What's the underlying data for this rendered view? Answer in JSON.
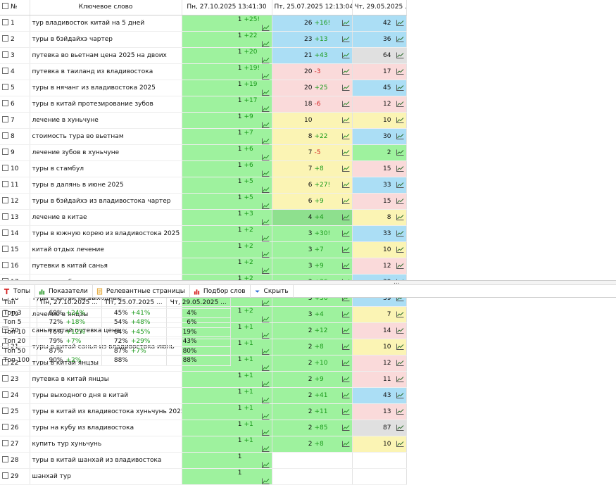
{
  "columns": {
    "num": "№",
    "keyword": "Ключевое слово",
    "date1": "Пн, 27.10.2025 13:41:30",
    "date2": "Пт, 25.07.2025 12:13:04",
    "date3": "Чт, 29.05.2025 ..."
  },
  "cell_colors": {
    "g": "#9ef29e",
    "b": "#abdef5",
    "p": "#fadada",
    "y": "#fbf4b4",
    "s": "#e0e0e0",
    "dg": "#8ee08e"
  },
  "rows": [
    {
      "n": "1",
      "kw": "тур владивосток китай на 5 дней",
      "p1": "1",
      "d1": "+25!",
      "c1": "g",
      "p2": "26",
      "d2": "+16!",
      "c2": "b",
      "p3": "42",
      "c3": "b"
    },
    {
      "n": "2",
      "kw": "туры в бэйдайхэ чартер",
      "p1": "1",
      "d1": "+22",
      "c1": "g",
      "p2": "23",
      "d2": "+13",
      "c2": "b",
      "p3": "36",
      "c3": "b"
    },
    {
      "n": "3",
      "kw": "путевка во вьетнам цена 2025 на двоих",
      "p1": "1",
      "d1": "+20",
      "c1": "g",
      "p2": "21",
      "d2": "+43",
      "c2": "b",
      "p3": "64",
      "c3": "s"
    },
    {
      "n": "4",
      "kw": "путевка в таиланд из владивостока",
      "p1": "1",
      "d1": "+19!",
      "c1": "g",
      "p2": "20",
      "d2": "-3",
      "c2": "p",
      "p3": "17",
      "c3": "p"
    },
    {
      "n": "5",
      "kw": "туры в нячанг из владивостока 2025",
      "p1": "1",
      "d1": "+19",
      "c1": "g",
      "p2": "20",
      "d2": "+25",
      "c2": "p",
      "p3": "45",
      "c3": "b"
    },
    {
      "n": "6",
      "kw": "туры в китай протезирование зубов",
      "p1": "1",
      "d1": "+17",
      "c1": "g",
      "p2": "18",
      "d2": "-6",
      "c2": "p",
      "p3": "12",
      "c3": "p"
    },
    {
      "n": "7",
      "kw": "лечение в хуньчуне",
      "p1": "1",
      "d1": "+9",
      "c1": "g",
      "p2": "10",
      "d2": "",
      "c2": "y",
      "p3": "10",
      "c3": "y"
    },
    {
      "n": "8",
      "kw": "стоимость тура во вьетнам",
      "p1": "1",
      "d1": "+7",
      "c1": "g",
      "p2": "8",
      "d2": "+22",
      "c2": "y",
      "p3": "30",
      "c3": "b"
    },
    {
      "n": "9",
      "kw": "лечение зубов в хуньчуне",
      "p1": "1",
      "d1": "+6",
      "c1": "g",
      "p2": "7",
      "d2": "-5",
      "c2": "y",
      "p3": "2",
      "c3": "g"
    },
    {
      "n": "10",
      "kw": "туры в стамбул",
      "p1": "1",
      "d1": "+6",
      "c1": "g",
      "p2": "7",
      "d2": "+8",
      "c2": "y",
      "p3": "15",
      "c3": "p"
    },
    {
      "n": "11",
      "kw": "туры в далянь в июне 2025",
      "p1": "1",
      "d1": "+5",
      "c1": "g",
      "p2": "6",
      "d2": "+27!",
      "c2": "y",
      "p3": "33",
      "c3": "b"
    },
    {
      "n": "12",
      "kw": "туры в бэйдайхэ из владивостока чартер",
      "p1": "1",
      "d1": "+5",
      "c1": "g",
      "p2": "6",
      "d2": "+9",
      "c2": "y",
      "p3": "15",
      "c3": "p"
    },
    {
      "n": "13",
      "kw": "лечение в китае",
      "p1": "1",
      "d1": "+3",
      "c1": "g",
      "p2": "4",
      "d2": "+4",
      "c2": "dg",
      "p3": "8",
      "c3": "y"
    },
    {
      "n": "14",
      "kw": "туры в южную корею из владивостока 2025",
      "p1": "1",
      "d1": "+2",
      "c1": "g",
      "p2": "3",
      "d2": "+30!",
      "c2": "g",
      "p3": "33",
      "c3": "b"
    },
    {
      "n": "15",
      "kw": "китай отдых лечение",
      "p1": "1",
      "d1": "+2",
      "c1": "g",
      "p2": "3",
      "d2": "+7",
      "c2": "g",
      "p3": "10",
      "c3": "y"
    },
    {
      "n": "16",
      "kw": "путевки в китай санья",
      "p1": "1",
      "d1": "+2",
      "c1": "g",
      "p2": "3",
      "d2": "+9",
      "c2": "g",
      "p3": "12",
      "c3": "p"
    },
    {
      "n": "17",
      "kw": "туры на кубу",
      "p1": "1",
      "d1": "+2",
      "c1": "g",
      "p2": "3",
      "d2": "+36",
      "c2": "g",
      "p3": "39",
      "c3": "b"
    },
    {
      "n": "18",
      "kw": "туры в китай на выходные",
      "p1": "1",
      "d1": "+2",
      "c1": "g",
      "p2": "3",
      "d2": "+36",
      "c2": "g",
      "p3": "39",
      "c3": "b"
    },
    {
      "n": "19",
      "kw": "лечение в янцзы",
      "p1": "1",
      "d1": "+2",
      "c1": "g",
      "p2": "3",
      "d2": "+4",
      "c2": "g",
      "p3": "7",
      "c3": "y"
    },
    {
      "n": "20",
      "kw": "санья китай путевка цена",
      "p1": "1",
      "d1": "+1",
      "c1": "g",
      "p2": "2",
      "d2": "+12",
      "c2": "g",
      "p3": "14",
      "c3": "p"
    },
    {
      "n": "21",
      "kw": "туры в китай санья из владивостока июнь",
      "p1": "1",
      "d1": "+1",
      "c1": "g",
      "p2": "2",
      "d2": "+8",
      "c2": "g",
      "p3": "10",
      "c3": "y"
    },
    {
      "n": "22",
      "kw": "туры в китай янцзы",
      "p1": "1",
      "d1": "+1",
      "c1": "g",
      "p2": "2",
      "d2": "+10",
      "c2": "g",
      "p3": "12",
      "c3": "p"
    },
    {
      "n": "23",
      "kw": "путевка в китай янцзы",
      "p1": "1",
      "d1": "+1",
      "c1": "g",
      "p2": "2",
      "d2": "+9",
      "c2": "g",
      "p3": "11",
      "c3": "p"
    },
    {
      "n": "24",
      "kw": "туры выходного дня в китай",
      "p1": "1",
      "d1": "+1",
      "c1": "g",
      "p2": "2",
      "d2": "+41",
      "c2": "g",
      "p3": "43",
      "c3": "b"
    },
    {
      "n": "25",
      "kw": "туры в китай из владивостока хуньчунь 2025",
      "p1": "1",
      "d1": "+1",
      "c1": "g",
      "p2": "2",
      "d2": "+11",
      "c2": "g",
      "p3": "13",
      "c3": "p"
    },
    {
      "n": "26",
      "kw": "туры на кубу из владивостока",
      "p1": "1",
      "d1": "+1",
      "c1": "g",
      "p2": "2",
      "d2": "+85",
      "c2": "g",
      "p3": "87",
      "c3": "s"
    },
    {
      "n": "27",
      "kw": "купить тур хуньчунь",
      "p1": "1",
      "d1": "+1",
      "c1": "g",
      "p2": "2",
      "d2": "+8",
      "c2": "g",
      "p3": "10",
      "c3": "y"
    },
    {
      "n": "28",
      "kw": "туры в китай шанхай из владивостока",
      "p1": "1",
      "d1": "",
      "c1": "g",
      "p2": "",
      "d2": "",
      "c2": "",
      "p3": "",
      "c3": ""
    },
    {
      "n": "29",
      "kw": "шанхай тур",
      "p1": "1",
      "d1": "",
      "c1": "g",
      "p2": "",
      "d2": "",
      "c2": "",
      "p3": "",
      "c3": ""
    }
  ],
  "splitter_grip": "...",
  "tabs": [
    {
      "label": "Топы",
      "icon": "tops-icon",
      "color": "#d42020"
    },
    {
      "label": "Показатели",
      "icon": "bar-chart-icon",
      "color": "#2a9a2a"
    },
    {
      "label": "Релевантные страницы",
      "icon": "page-icon",
      "color": "#e0a030"
    },
    {
      "label": "Подбор слов",
      "icon": "bar-chart-red-icon",
      "color": "#d42020"
    },
    {
      "label": "Скрыть",
      "icon": "chevron-down-icon",
      "color": "#2a6ad4"
    }
  ],
  "tops": {
    "headers": [
      "Топ",
      "Пн, 27.10.2025 ...",
      "Пт, 25.07.2025 ...",
      "Чт, 29.05.2025 ..."
    ],
    "rows": [
      {
        "label": "Топ 3",
        "v1": "69%",
        "d1": "+24%",
        "v2": "45%",
        "d2": "+41%",
        "v3": "4%"
      },
      {
        "label": "Топ 5",
        "v1": "72%",
        "d1": "+18%",
        "v2": "54%",
        "d2": "+48%",
        "v3": "6%"
      },
      {
        "label": "Топ 10",
        "v1": "76%",
        "d1": "+12%",
        "v2": "64%",
        "d2": "+45%",
        "v3": "19%"
      },
      {
        "label": "Топ 20",
        "v1": "79%",
        "d1": "+7%",
        "v2": "72%",
        "d2": "+29%",
        "v3": "43%"
      },
      {
        "label": "Топ 50",
        "v1": "87%",
        "d1": "",
        "v2": "87%",
        "d2": "+7%",
        "v3": "80%"
      },
      {
        "label": "Топ 100",
        "v1": "90%",
        "d1": "+2%",
        "v2": "88%",
        "d2": "",
        "v3": "88%"
      }
    ]
  }
}
